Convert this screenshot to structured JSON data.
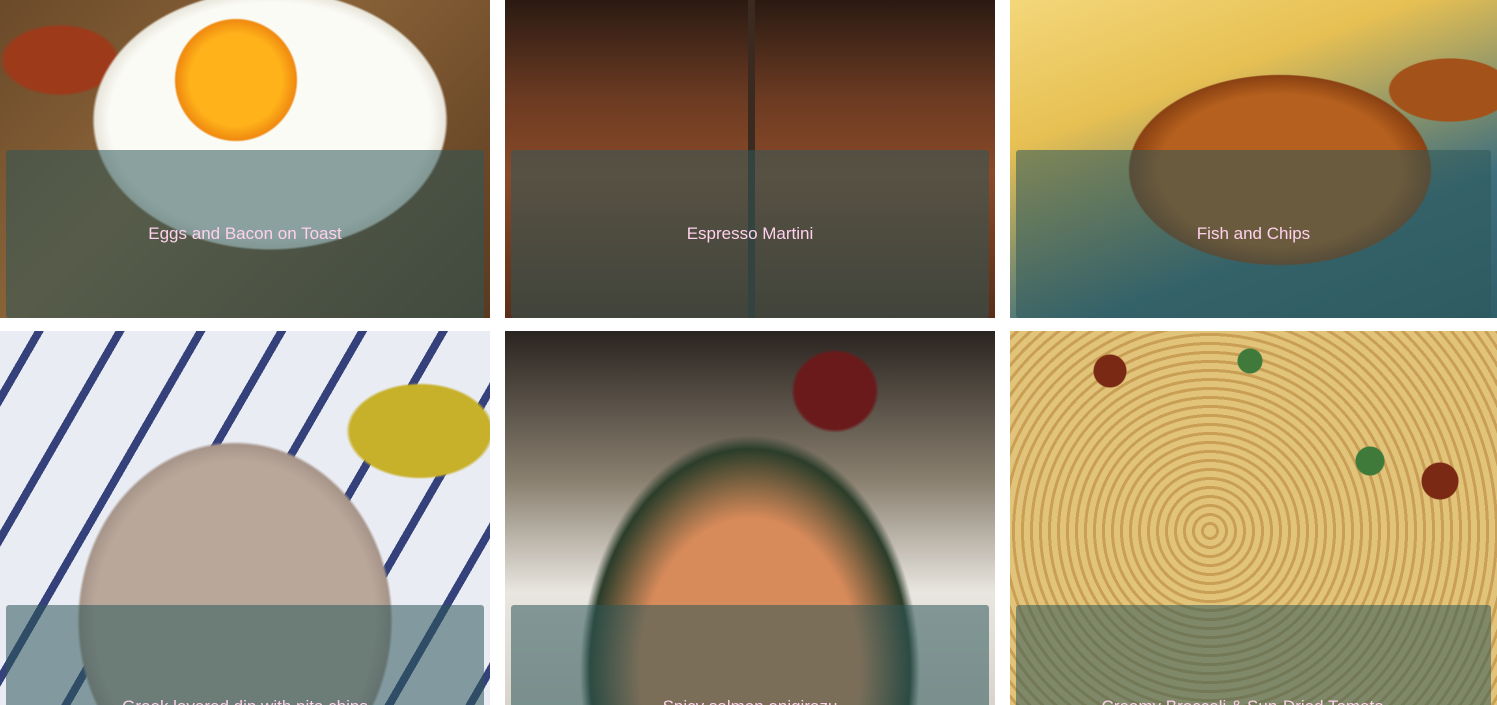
{
  "cards": [
    {
      "title": "Eggs and Bacon on Toast"
    },
    {
      "title": "Espresso Martini"
    },
    {
      "title": "Fish and Chips"
    },
    {
      "title": "Greek layered dip with pita chips"
    },
    {
      "title": "Spicy salmon onigirazu"
    },
    {
      "title": "Creamy Broccoli & Sun-Dried Tomato …"
    }
  ],
  "colors": {
    "overlay": "#2d585a",
    "title_text": "#ffd1ec"
  }
}
